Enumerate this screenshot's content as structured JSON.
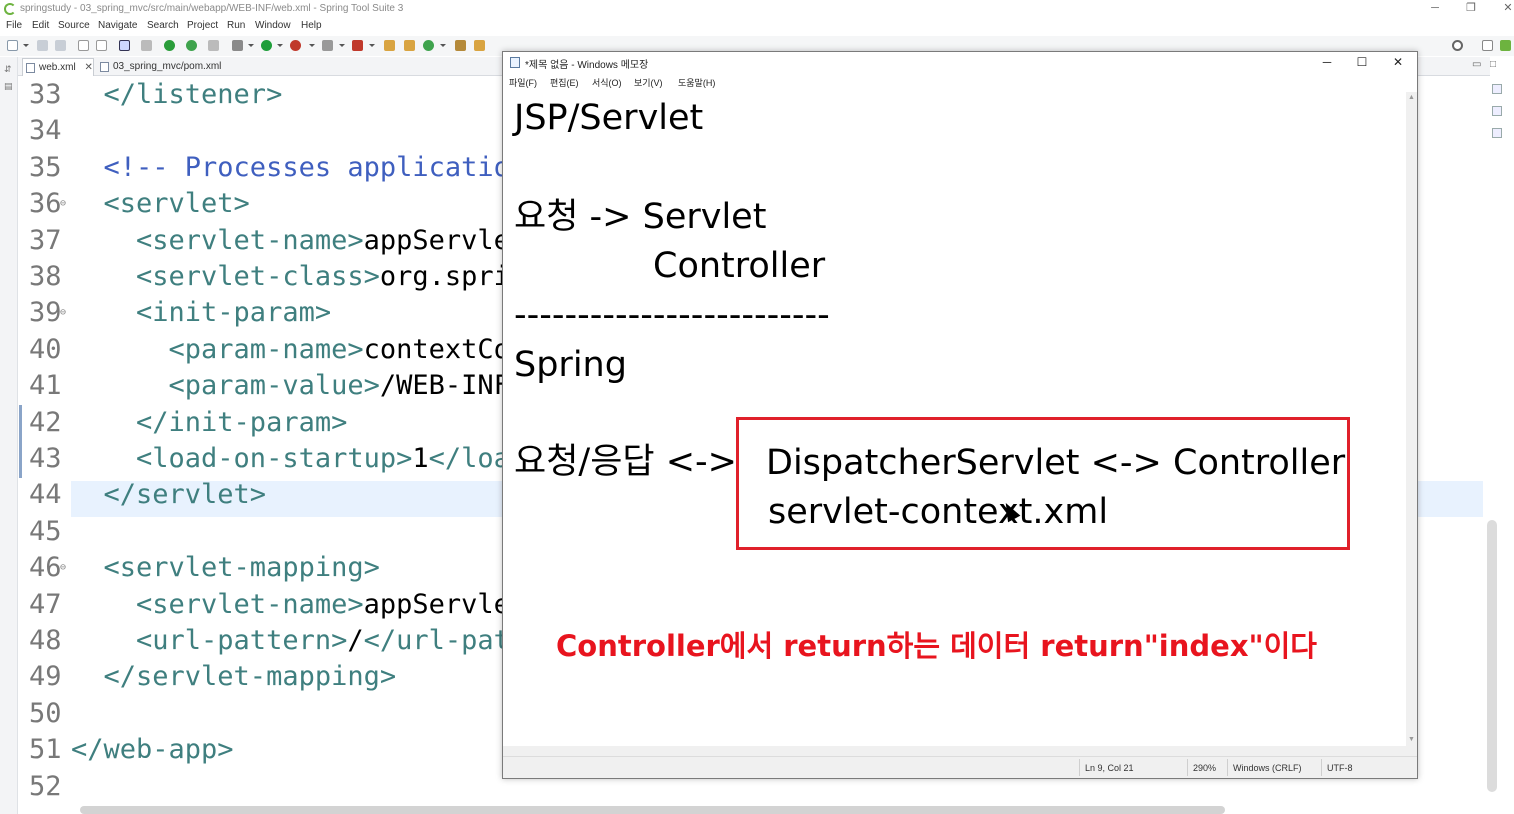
{
  "eclipse": {
    "title": "springstudy - 03_spring_mvc/src/main/webapp/WEB-INF/web.xml - Spring Tool Suite 3",
    "menu": [
      "File",
      "Edit",
      "Source",
      "Navigate",
      "Search",
      "Project",
      "Run",
      "Window",
      "Help"
    ],
    "tabs": [
      {
        "label": "web.xml",
        "active": true
      },
      {
        "label": "03_spring_mvc/pom.xml",
        "active": false
      }
    ],
    "code_lines": [
      {
        "num": "33",
        "fold": "",
        "parts": [
          [
            "tag",
            "  </listener>"
          ]
        ]
      },
      {
        "num": "34",
        "fold": "",
        "parts": []
      },
      {
        "num": "35",
        "fold": "",
        "parts": [
          [
            "cmt",
            "  <!-- Processes applicatio"
          ]
        ]
      },
      {
        "num": "36",
        "fold": "⊖",
        "parts": [
          [
            "tag",
            "  <servlet>"
          ]
        ]
      },
      {
        "num": "37",
        "fold": "",
        "parts": [
          [
            "tag",
            "    <servlet-name>"
          ],
          [
            "txt",
            "appServle"
          ]
        ]
      },
      {
        "num": "38",
        "fold": "",
        "parts": [
          [
            "tag",
            "    <servlet-class>"
          ],
          [
            "txt",
            "org.spri"
          ]
        ]
      },
      {
        "num": "39",
        "fold": "⊖",
        "parts": [
          [
            "tag",
            "    <init-param>"
          ]
        ]
      },
      {
        "num": "40",
        "fold": "",
        "parts": [
          [
            "tag",
            "      <param-name>"
          ],
          [
            "txt",
            "contextCo"
          ]
        ]
      },
      {
        "num": "41",
        "fold": "",
        "parts": [
          [
            "tag",
            "      <param-value>"
          ],
          [
            "txt",
            "/WEB-INF"
          ]
        ]
      },
      {
        "num": "42",
        "fold": "",
        "parts": [
          [
            "tag",
            "    </init-param>"
          ]
        ]
      },
      {
        "num": "43",
        "fold": "",
        "parts": [
          [
            "tag",
            "    <load-on-startup>"
          ],
          [
            "txt",
            "1"
          ],
          [
            "tag",
            "</loa"
          ]
        ]
      },
      {
        "num": "44",
        "fold": "",
        "parts": [
          [
            "tag",
            "  </servlet>"
          ]
        ]
      },
      {
        "num": "45",
        "fold": "",
        "parts": []
      },
      {
        "num": "46",
        "fold": "⊖",
        "parts": [
          [
            "tag",
            "  <servlet-mapping>"
          ]
        ]
      },
      {
        "num": "47",
        "fold": "",
        "parts": [
          [
            "tag",
            "    <servlet-name>"
          ],
          [
            "txt",
            "appServle"
          ]
        ]
      },
      {
        "num": "48",
        "fold": "",
        "parts": [
          [
            "tag",
            "    <url-pattern>"
          ],
          [
            "txt",
            "/"
          ],
          [
            "tag",
            "</url-pat"
          ]
        ]
      },
      {
        "num": "49",
        "fold": "",
        "parts": [
          [
            "tag",
            "  </servlet-mapping>"
          ]
        ]
      },
      {
        "num": "50",
        "fold": "",
        "parts": []
      },
      {
        "num": "51",
        "fold": "",
        "parts": [
          [
            "tag",
            "</web-app>"
          ]
        ]
      },
      {
        "num": "52",
        "fold": "",
        "parts": []
      }
    ]
  },
  "notepad": {
    "title": "*제목 없음 - Windows 메모장",
    "menu": [
      "파일(F)",
      "편집(E)",
      "서식(O)",
      "보기(V)",
      "도움말(H)"
    ],
    "lines": {
      "l1": "JSP/Servlet",
      "l2": "요청 -> Servlet",
      "l3": "Controller",
      "l4": "-------------------------",
      "l5": "Spring",
      "l6a": "요청/응답 <->",
      "l6b": "DispatcherServlet <-> Controller",
      "l7": "servlet-context.xml"
    },
    "annotation": "Controller에서 return하는 데이터 return\"index\"이다",
    "status": {
      "position": "Ln 9, Col 21",
      "zoom": "290%",
      "line_ending": "Windows (CRLF)",
      "encoding": "UTF-8"
    }
  },
  "colors": {
    "tag": "#3f7f7f",
    "comment": "#3f5fbf",
    "highlight": "#e8f2fe",
    "annotation": "#e8141e"
  }
}
